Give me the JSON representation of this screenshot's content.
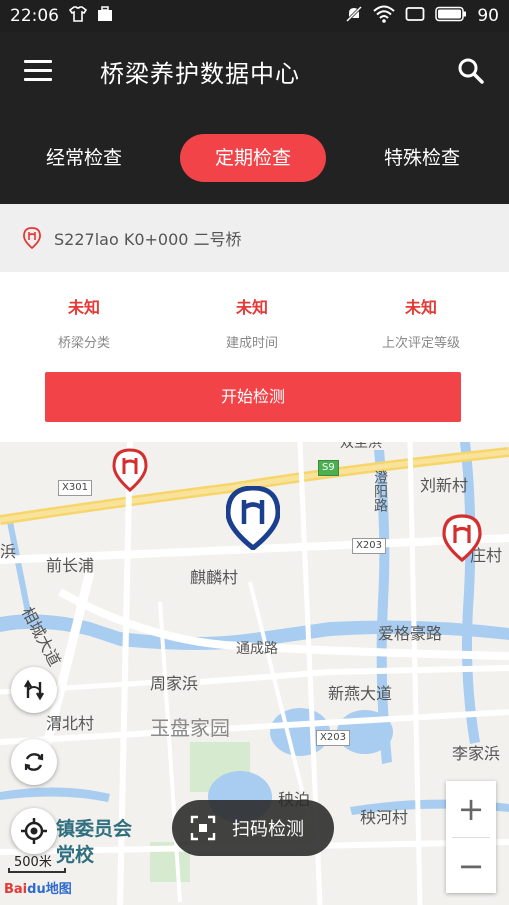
{
  "status": {
    "time": "22:06",
    "battery": "90"
  },
  "app": {
    "title": "桥梁养护数据中心"
  },
  "tabs": [
    {
      "label": "经常检查",
      "active": false
    },
    {
      "label": "定期检查",
      "active": true
    },
    {
      "label": "特殊检查",
      "active": false
    }
  ],
  "location": {
    "text": "S227lao  K0+000  二号桥"
  },
  "info": [
    {
      "value": "未知",
      "label": "桥梁分类"
    },
    {
      "value": "未知",
      "label": "建成时间"
    },
    {
      "value": "未知",
      "label": "上次评定等级"
    }
  ],
  "start_button": "开始检测",
  "map": {
    "labels": {
      "top_partial": "双至浜",
      "liuxin": "刘新村",
      "chengyang": "澄阳路",
      "qilin": "麒麟村",
      "qianchangpu": "前长浦",
      "chengcheng": "相城大道",
      "lejia": "浜",
      "right_village": "庄村",
      "aige": "爱格豪路",
      "tongcheng": "通成路",
      "zhoujia": "周家浜",
      "xinyan": "新燕大道",
      "weibei": "渭北村",
      "yupan": "玉盘家园",
      "lijia": "李家浜",
      "qiuhe": "秧河村",
      "qiubo": "秧泊",
      "town": "镇委员会",
      "party": "党校"
    },
    "badges": {
      "x301": "X301",
      "s9": "S9",
      "x203a": "X203",
      "x203b": "X203"
    },
    "scale": "500米",
    "logo_a": "Bai",
    "logo_b": "du地图"
  },
  "scan_button": "扫码检测",
  "zoom": {
    "in": "+",
    "out": "−"
  },
  "colors": {
    "accent": "#f24448",
    "header": "#222222",
    "marker_blue": "#1b3f8f"
  }
}
